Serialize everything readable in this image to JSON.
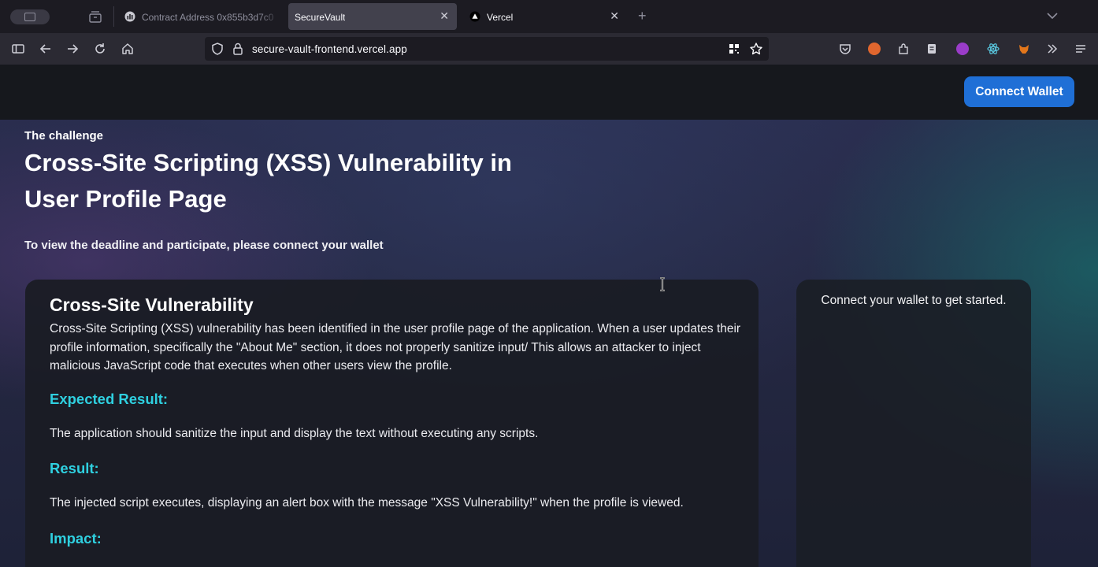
{
  "browser": {
    "tabs": [
      {
        "label": "Contract Address 0x855b3d7c0"
      },
      {
        "label": "SecureVault",
        "active": true
      },
      {
        "label": "Vercel"
      }
    ],
    "url": "secure-vault-frontend.vercel.app"
  },
  "header": {
    "connect_label": "Connect Wallet"
  },
  "hero": {
    "eyebrow": "The challenge",
    "title": "Cross-Site Scripting (XSS) Vulnerability in User Profile Page",
    "subtitle": "To view the deadline and participate, please connect your wallet"
  },
  "details": {
    "heading": "Cross-Site Vulnerability",
    "description": "Cross-Site Scripting (XSS) vulnerability has been identified in the user profile page of the application. When a user updates their profile information, specifically the \"About Me\" section, it does not properly sanitize input/ This allows an attacker to inject malicious JavaScript code that executes when other users view the profile.",
    "expected_heading": "Expected Result:",
    "expected_text": "The application should sanitize the input and display the text without executing any scripts.",
    "result_heading": "Result:",
    "result_text": "The injected script executes, displaying an alert box with the message \"XSS Vulnerability!\" when the profile is viewed.",
    "impact_heading": "Impact:"
  },
  "side_panel": {
    "message": "Connect your wallet to get started."
  },
  "colors": {
    "accent_button": "#1f6fd6",
    "section_heading": "#2fd0e0"
  }
}
